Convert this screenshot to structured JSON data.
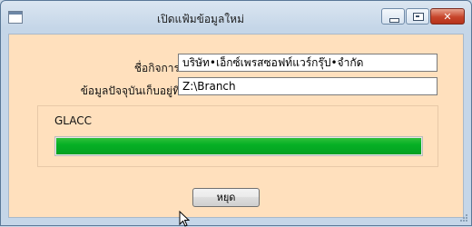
{
  "window": {
    "title": "เปิดแฟ้มข้อมูลใหม่",
    "controls": {
      "close_glyph": "✕"
    }
  },
  "form": {
    "company_label": "ชื่อกิจการ",
    "company_value": "บริษัท•เอ็กซ์เพรสซอฟท์แวร์กรุ๊ป•จำกัด",
    "location_label": "ข้อมูลปัจจุบันเก็บอยู่ที่",
    "location_value": "Z:\\Branch"
  },
  "progress": {
    "label": "GLACC",
    "value_fraction": 1.0,
    "color": "#06b025"
  },
  "actions": {
    "stop_label": "หยุด"
  }
}
